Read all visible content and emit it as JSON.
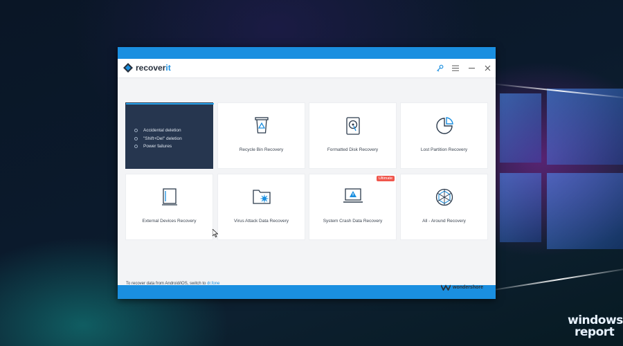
{
  "window": {
    "app_name_part1": "recover",
    "app_name_part2": "it",
    "controls": [
      "key-icon",
      "menu-icon",
      "minimize-icon",
      "close-icon"
    ]
  },
  "active_card": {
    "features": [
      "Accidental deletion",
      "\"Shift+Del\" deletion",
      "Power failures"
    ]
  },
  "cards": [
    {
      "label": "Recycle Bin Recovery",
      "icon": "recycle-bin-icon"
    },
    {
      "label": "Formatted Disk Recovery",
      "icon": "hard-disk-icon"
    },
    {
      "label": "Lost Partition Recovery",
      "icon": "partition-icon"
    },
    {
      "label": "External Devices Recovery",
      "icon": "external-device-icon"
    },
    {
      "label": "Virus Attack Data Recovery",
      "icon": "virus-folder-icon"
    },
    {
      "label": "System Crash Data Recovery",
      "icon": "laptop-warning-icon",
      "badge": "Ultimate"
    },
    {
      "label": "All - Around Recovery",
      "icon": "all-around-icon"
    }
  ],
  "footer": {
    "note_text": "To recover data from Android/iOS, switch to ",
    "link_text": "dr.fone",
    "vendor": "wondershore"
  },
  "watermark": {
    "line1": "windows",
    "line2": "report"
  },
  "colors": {
    "accent": "#1a8fe0",
    "active_card": "#26364f",
    "badge": "#f0564c"
  }
}
